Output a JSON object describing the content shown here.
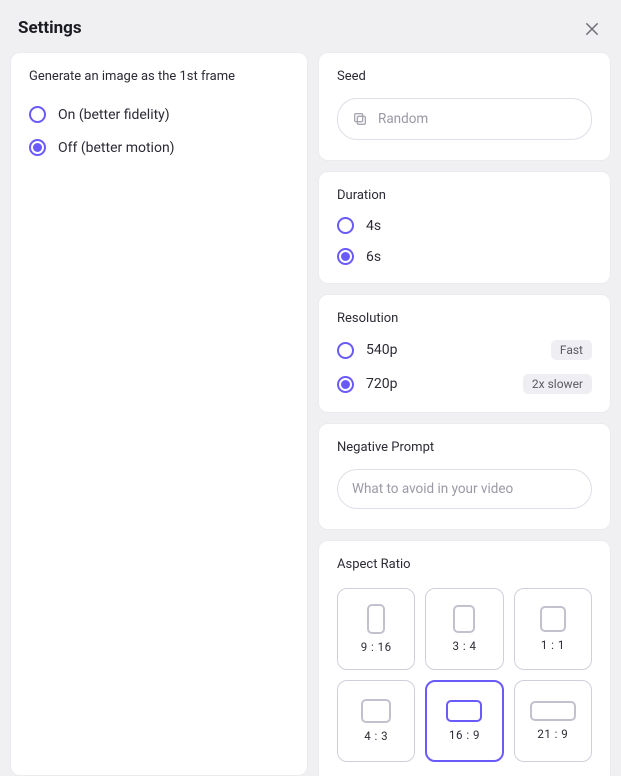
{
  "title": "Settings",
  "first_frame": {
    "label": "Generate an image as the 1st frame",
    "options": [
      {
        "label": "On (better fidelity)",
        "selected": false
      },
      {
        "label": "Off (better motion)",
        "selected": true
      }
    ]
  },
  "seed": {
    "label": "Seed",
    "placeholder": "Random"
  },
  "duration": {
    "label": "Duration",
    "options": [
      {
        "label": "4s",
        "selected": false
      },
      {
        "label": "6s",
        "selected": true
      }
    ]
  },
  "resolution": {
    "label": "Resolution",
    "options": [
      {
        "label": "540p",
        "selected": false,
        "chip": "Fast"
      },
      {
        "label": "720p",
        "selected": true,
        "chip": "2x slower"
      }
    ]
  },
  "negative_prompt": {
    "label": "Negative Prompt",
    "placeholder": "What to avoid in your video"
  },
  "aspect_ratio": {
    "label": "Aspect Ratio",
    "options": [
      {
        "label": "9 : 16",
        "shape": "s-9-16",
        "selected": false
      },
      {
        "label": "3 : 4",
        "shape": "s-3-4",
        "selected": false
      },
      {
        "label": "1 : 1",
        "shape": "s-1-1",
        "selected": false
      },
      {
        "label": "4 : 3",
        "shape": "s-4-3",
        "selected": false
      },
      {
        "label": "16 : 9",
        "shape": "s-16-9",
        "selected": true
      },
      {
        "label": "21 : 9",
        "shape": "s-21-9",
        "selected": false
      }
    ]
  }
}
